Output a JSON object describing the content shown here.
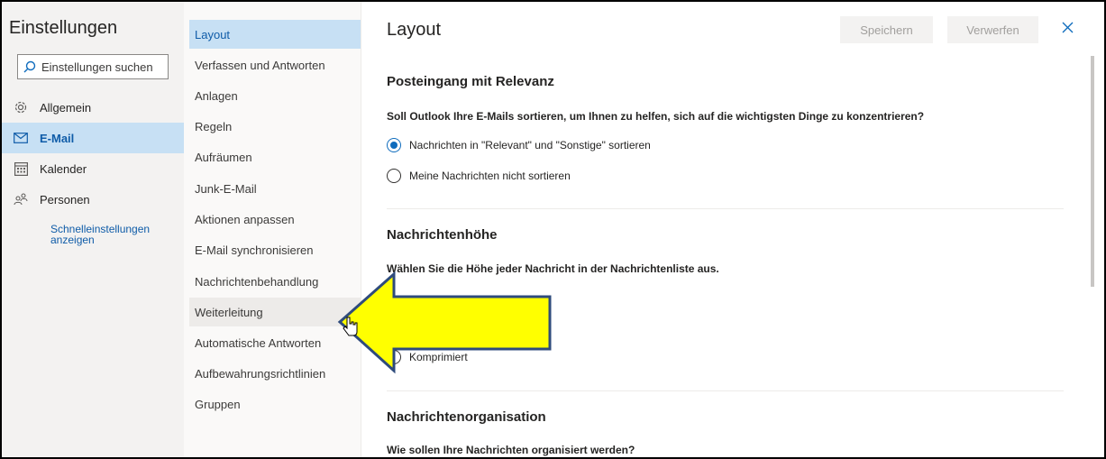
{
  "app_title": "Einstellungen",
  "search": {
    "label": "Einstellungen suchen",
    "icon": "search-icon"
  },
  "left_nav": {
    "items": [
      {
        "label": "Allgemein",
        "icon": "gear-icon"
      },
      {
        "label": "E-Mail",
        "icon": "mail-icon",
        "selected": true
      },
      {
        "label": "Kalender",
        "icon": "calendar-icon"
      },
      {
        "label": "Personen",
        "icon": "people-icon"
      }
    ],
    "quick_settings": "Schnelleinstellungen anzeigen"
  },
  "mid_nav": {
    "items": [
      {
        "label": "Layout",
        "selected": true
      },
      {
        "label": "Verfassen und Antworten"
      },
      {
        "label": "Anlagen"
      },
      {
        "label": "Regeln"
      },
      {
        "label": "Aufräumen"
      },
      {
        "label": "Junk-E-Mail"
      },
      {
        "label": "Aktionen anpassen"
      },
      {
        "label": "E-Mail synchronisieren"
      },
      {
        "label": "Nachrichtenbehandlung"
      },
      {
        "label": "Weiterleitung",
        "hover": true
      },
      {
        "label": "Automatische Antworten"
      },
      {
        "label": "Aufbewahrungsrichtlinien"
      },
      {
        "label": "Gruppen"
      }
    ]
  },
  "content": {
    "title": "Layout",
    "save_label": "Speichern",
    "discard_label": "Verwerfen",
    "close_icon": "close-icon",
    "sections": [
      {
        "heading": "Posteingang mit Relevanz",
        "question": "Soll Outlook Ihre E-Mails sortieren, um Ihnen zu helfen, sich auf die wichtigsten Dinge zu konzentrieren?",
        "options": [
          {
            "label": "Nachrichten in \"Relevant\" und \"Sonstige\" sortieren",
            "checked": true
          },
          {
            "label": "Meine Nachrichten nicht sortieren",
            "checked": false
          }
        ]
      },
      {
        "heading": "Nachrichtenhöhe",
        "question": "Wählen Sie die Höhe jeder Nachricht in der Nachrichtenliste aus.",
        "options": [
          {
            "label": "Komprimiert",
            "checked": false
          }
        ]
      },
      {
        "heading": "Nachrichtenorganisation",
        "question": "Wie sollen Ihre Nachrichten organisiert werden?"
      }
    ]
  },
  "annotation": {
    "arrow_color": "#ffff00",
    "arrow_outline": "#2f4b7c",
    "cursor": "hand-pointer-icon"
  }
}
